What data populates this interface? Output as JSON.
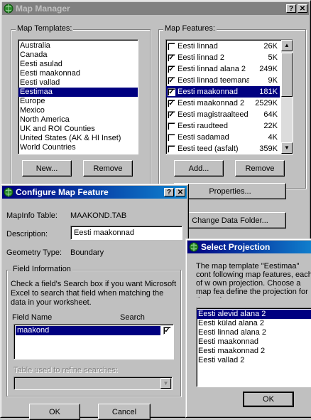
{
  "map_manager": {
    "title": "Map Manager",
    "help_btn": "?",
    "close_btn": "✕",
    "templates_label": "Map Templates:",
    "templates": [
      "Australia",
      "Canada",
      "Eesti asulad",
      "Eesti maakonnad",
      "Eesti vallad",
      "Eestimaa",
      "Europe",
      "Mexico",
      "North America",
      "UK and ROI Counties",
      "United States (AK & HI Inset)",
      "World Countries"
    ],
    "selected_template": 5,
    "new_btn": "New...",
    "remove_btn": "Remove",
    "features_label": "Map Features:",
    "features": [
      {
        "name": "Eesti linnad",
        "size": "26K",
        "checked": false
      },
      {
        "name": "Eesti linnad 2",
        "size": "5K",
        "checked": true
      },
      {
        "name": "Eesti linnad alana 2",
        "size": "249K",
        "checked": true
      },
      {
        "name": "Eesti linnad teemana 2",
        "size": "9K",
        "checked": true
      },
      {
        "name": "Eesti maakonnad",
        "size": "181K",
        "checked": true,
        "selected": true
      },
      {
        "name": "Eesti maakonnad 2",
        "size": "2529K",
        "checked": true
      },
      {
        "name": "Eesti magistraalteed 2",
        "size": "64K",
        "checked": true
      },
      {
        "name": "Eesti raudteed",
        "size": "22K",
        "checked": false
      },
      {
        "name": "Eesti sadamad",
        "size": "4K",
        "checked": false
      },
      {
        "name": "Eesti teed (asfalt)",
        "size": "359K",
        "checked": false
      }
    ],
    "add_btn": "Add...",
    "remove2_btn": "Remove",
    "properties_btn": "Properties...",
    "change_folder_btn": "Change Data Folder..."
  },
  "configure": {
    "title": "Configure Map Feature",
    "help_btn": "?",
    "close_btn": "✕",
    "mapinfo_label": "MapInfo Table:",
    "mapinfo_value": "MAAKOND.TAB",
    "desc_label": "Description:",
    "desc_value": "Eesti maakonnad",
    "geom_label": "Geometry Type:",
    "geom_value": "Boundary",
    "field_info_label": "Field Information",
    "help_text": "Check a field's Search box if you want Microsoft Excel to search that field when matching the data in your worksheet.",
    "col_field": "Field Name",
    "col_search": "Search",
    "fields": [
      {
        "name": "maakond",
        "search": true
      }
    ],
    "refine_label": "Table used to refine searches:",
    "ok_btn": "OK",
    "cancel_btn": "Cancel"
  },
  "projection": {
    "title": "Select Projection",
    "text": "The map template \"Eestimaa\" cont following map features, each of w own projection. Choose a map fea define the projection for the entire",
    "items": [
      "Eesti alevid alana 2",
      "Eesti külad alana 2",
      "Eesti linnad alana 2",
      "Eesti maakonnad",
      "Eesti maakonnad 2",
      "Eesti vallad 2"
    ],
    "selected": 0,
    "ok_btn": "OK"
  }
}
